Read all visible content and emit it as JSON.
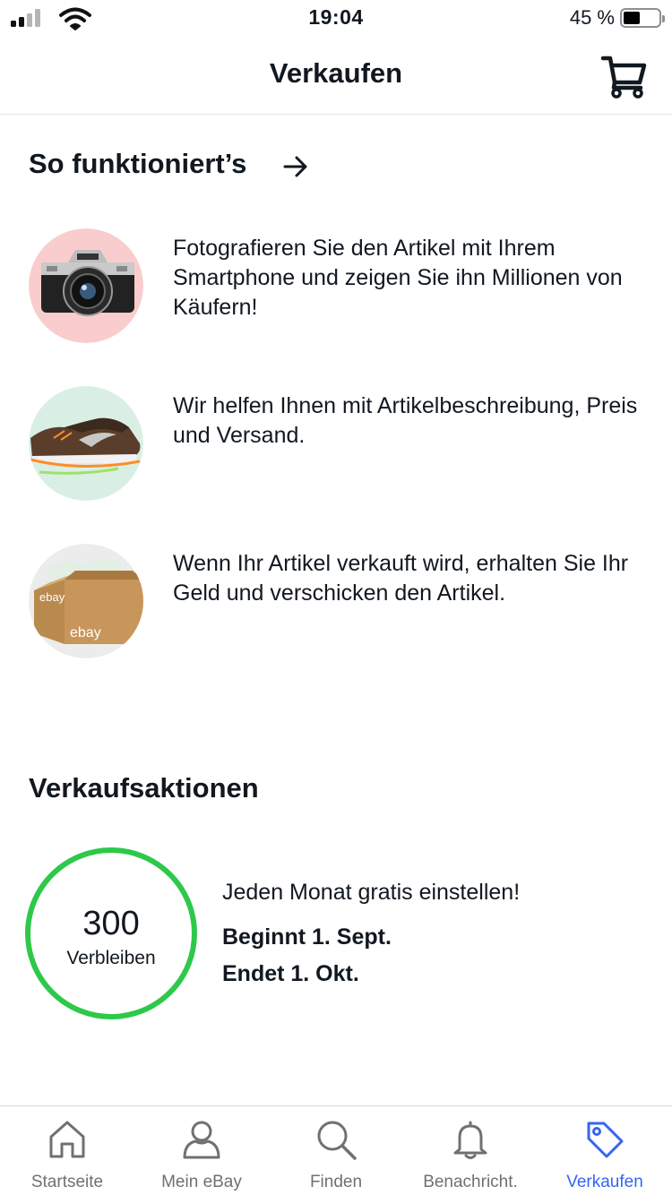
{
  "status_bar": {
    "time": "19:04",
    "battery_text": "45 %",
    "battery_level": 0.45,
    "icons": [
      "signal-icon",
      "wifi-icon",
      "battery-icon"
    ]
  },
  "header": {
    "title": "Verkaufen",
    "cart_icon": "cart-icon"
  },
  "how_it_works": {
    "title": "So funktioniert’s",
    "arrow_icon": "arrow-right-icon",
    "steps": [
      {
        "image": "camera-image",
        "image_bg": "#f9cdcd",
        "text": "Fotografieren Sie den Artikel mit Ihrem Smartphone und zeigen Sie ihn Millionen von Käufern!"
      },
      {
        "image": "sneaker-image",
        "image_bg": "#d9efe4",
        "text": "Wir helfen Ihnen mit Artikelbeschreibung, Preis und Versand."
      },
      {
        "image": "ebay-box-image",
        "image_bg": "#ececec",
        "text": "Wenn Ihr Artikel verkauft wird, erhalten Sie Ihr Geld und verschicken den Artikel."
      }
    ]
  },
  "promotions": {
    "title": "Verkaufsaktionen",
    "remaining_count": "300",
    "remaining_label": "Verbleiben",
    "ring_color": "#2ec84a",
    "headline": "Jeden Monat gratis einstellen!",
    "start": "Beginnt 1. Sept.",
    "end": "Endet 1. Okt."
  },
  "ebay_logo_text": "ebay",
  "tabbar": {
    "active_color": "#3665f3",
    "inactive_color": "#707070",
    "tabs": [
      {
        "label": "Startseite",
        "icon": "home-icon"
      },
      {
        "label": "Mein eBay",
        "icon": "profile-icon"
      },
      {
        "label": "Finden",
        "icon": "search-icon"
      },
      {
        "label": "Benachricht.",
        "icon": "bell-icon"
      },
      {
        "label": "Verkaufen",
        "icon": "tag-icon",
        "active": true
      }
    ]
  }
}
